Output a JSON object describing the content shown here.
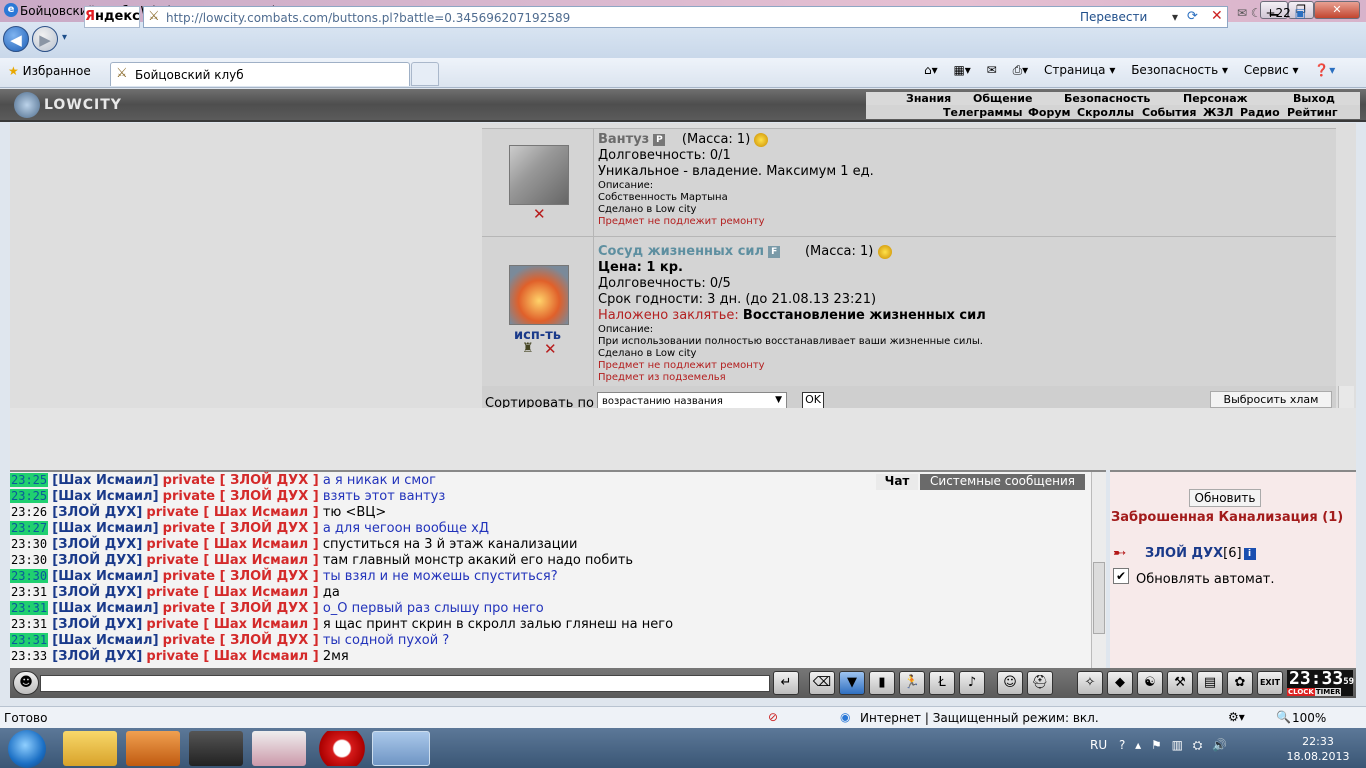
{
  "window": {
    "title": "Бойцовский клуб - Windows Internet Explorer",
    "min_label": "▁",
    "max_label": "❐",
    "close_label": "✕"
  },
  "browser": {
    "search_brand_1": "Я",
    "search_brand_2": "ндекс",
    "url": "http://lowcity.combats.com/buttons.pl?battle=0.345696207192589",
    "translate": "Перевести",
    "badge_count": "+22",
    "favorites": "Избранное",
    "tab_title": "Бойцовский клуб",
    "commands": [
      "Страница ▾",
      "Безопасность ▾",
      "Сервис ▾"
    ]
  },
  "game": {
    "logo": "LOWCITY",
    "menu_top": [
      "Знания",
      "Общение",
      "Безопасность",
      "Персонаж",
      "Выход"
    ],
    "menu_sub": [
      "Телеграммы",
      "Форум",
      "Скроллы",
      "События",
      "ЖЗЛ",
      "Радио",
      "Рейтинг"
    ]
  },
  "items": [
    {
      "name": "Вантуз",
      "badge": "P",
      "mass": "(Масса: 1)",
      "lines": [
        "Долговечность: 0/1",
        "Уникальное - владение. Максимум 1 ед."
      ],
      "desc_label": "Описание:",
      "desc": "Собственность Мартына",
      "made": "Сделано в Low city",
      "warn": [
        "Предмет не подлежит ремонту"
      ]
    },
    {
      "name": "Сосуд жизненных сил",
      "badge": "F",
      "mass": "(Масса: 1)",
      "price": "Цена: 1 кр.",
      "lines": [
        "Долговечность: 0/5",
        "Срок годности: 3 дн. (до 21.08.13 23:21)"
      ],
      "spell_label": "Наложено заклятье:",
      "spell": "Восстановление жизненных сил",
      "desc_label": "Описание:",
      "desc": "При использовании полностью восстанавливает ваши жизненные силы.",
      "made": "Сделано в Low city",
      "warn": [
        "Предмет не подлежит ремонту",
        "Предмет из подземелья"
      ],
      "use_label": "исп-ть"
    }
  ],
  "sort": {
    "label": "Сортировать по",
    "selected": "возрастанию названия",
    "ok": "OK",
    "drop_junk": "Выбросить хлам"
  },
  "chat": {
    "tabs": [
      "Чат",
      "Системные сообщения"
    ],
    "lines": [
      {
        "time": "23:25",
        "hl": true,
        "from": "[Шах Исмаил]",
        "to": "private [ ЗЛОЙ ДУХ ]",
        "msg": "а я никак и смог",
        "blue": true
      },
      {
        "time": "23:25",
        "hl": true,
        "from": "[Шах Исмаил]",
        "to": "private [ ЗЛОЙ ДУХ ]",
        "msg": "взять этот вантуз",
        "blue": true
      },
      {
        "time": "23:26",
        "hl": false,
        "from": "[ЗЛОЙ ДУХ]",
        "to": "private [ Шах Исмаил ]",
        "msg": "тю <ВЦ>",
        "blue": false
      },
      {
        "time": "23:27",
        "hl": true,
        "from": "[Шах Исмаил]",
        "to": "private [ ЗЛОЙ ДУХ ]",
        "msg": "а для чегоон вообще хД",
        "blue": true
      },
      {
        "time": "23:30",
        "hl": false,
        "from": "[ЗЛОЙ ДУХ]",
        "to": "private [ Шах Исмаил ]",
        "msg": "спуститься на 3 й этаж канализации",
        "blue": false
      },
      {
        "time": "23:30",
        "hl": false,
        "from": "[ЗЛОЙ ДУХ]",
        "to": "private [ Шах Исмаил ]",
        "msg": "там главный монстр акакий его надо побить",
        "blue": false
      },
      {
        "time": "23:30",
        "hl": true,
        "from": "[Шах Исмаил]",
        "to": "private [ ЗЛОЙ ДУХ ]",
        "msg": "ты взял и не можешь спуститься?",
        "blue": true
      },
      {
        "time": "23:31",
        "hl": false,
        "from": "[ЗЛОЙ ДУХ]",
        "to": "private [ Шах Исмаил ]",
        "msg": "да",
        "blue": false
      },
      {
        "time": "23:31",
        "hl": true,
        "from": "[Шах Исмаил]",
        "to": "private [ ЗЛОЙ ДУХ ]",
        "msg": "о_О первый раз слышу про него",
        "blue": true
      },
      {
        "time": "23:31",
        "hl": false,
        "from": "[ЗЛОЙ ДУХ]",
        "to": "private [ Шах Исмаил ]",
        "msg": "я щас принт скрин в скролл залью глянеш на него",
        "blue": false
      },
      {
        "time": "23:31",
        "hl": true,
        "from": "[Шах Исмаил]",
        "to": "private [ ЗЛОЙ ДУХ ]",
        "msg": "ты содной пухой ?",
        "blue": true
      },
      {
        "time": "23:33",
        "hl": false,
        "from": "[ЗЛОЙ ДУХ]",
        "to": "private [ Шах Исмаил ]",
        "msg": "2мя",
        "blue": false
      }
    ]
  },
  "online": {
    "refresh": "Обновить",
    "location": "Заброшенная Канализация (1)",
    "player": "ЗЛОЙ ДУХ",
    "level": "[6]",
    "info_badge": "i",
    "auto_refresh": "Обновлять автомат.",
    "auto_checked": true
  },
  "clock": {
    "time": "23:33",
    "seconds": "59",
    "label_clock": "CLOCK",
    "label_timer": "TIMER"
  },
  "status": {
    "ready": "Готово",
    "zone": "Интернет | Защищенный режим: вкл.",
    "zoom": "100%"
  },
  "taskbar": {
    "lang": "RU",
    "time": "22:33",
    "date": "18.08.2013"
  },
  "colors": {
    "time_highlight": "#20d070",
    "nick": "#1a3a8a",
    "private": "#d42a2a",
    "message_blue": "#2233bb",
    "location": "#a21b1b"
  }
}
